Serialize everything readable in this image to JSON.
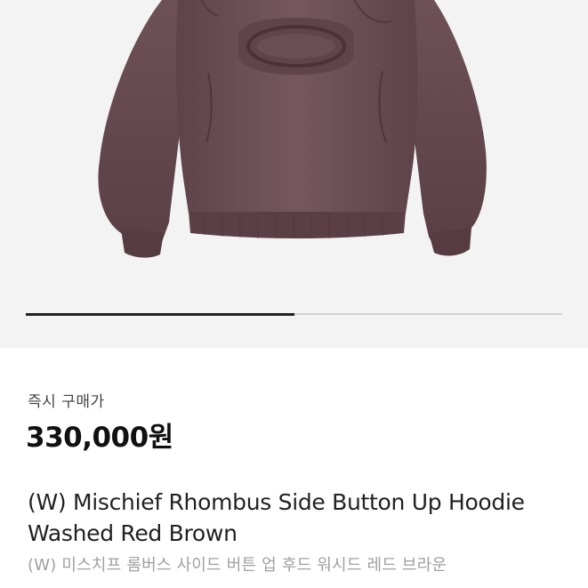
{
  "product_image": {
    "alt": "hoodie-product-photo",
    "garment_color": "#6e4f57",
    "background_color": "#f3f3f3"
  },
  "carousel": {
    "progress": 0.5
  },
  "price_section": {
    "label": "즉시 구매가",
    "price": "330,000원"
  },
  "product": {
    "title": "(W) Mischief Rhombus Side Button Up Hoodie Washed Red Brown",
    "subtitle": "(W) 미스치프 롬버스 사이드 버튼 업 후드 워시드 레드 브라운"
  },
  "colors": {
    "progress_fill": "#222222",
    "progress_track": "#cfcfcf",
    "text_primary": "#111111",
    "text_secondary": "#a0a0a0"
  }
}
